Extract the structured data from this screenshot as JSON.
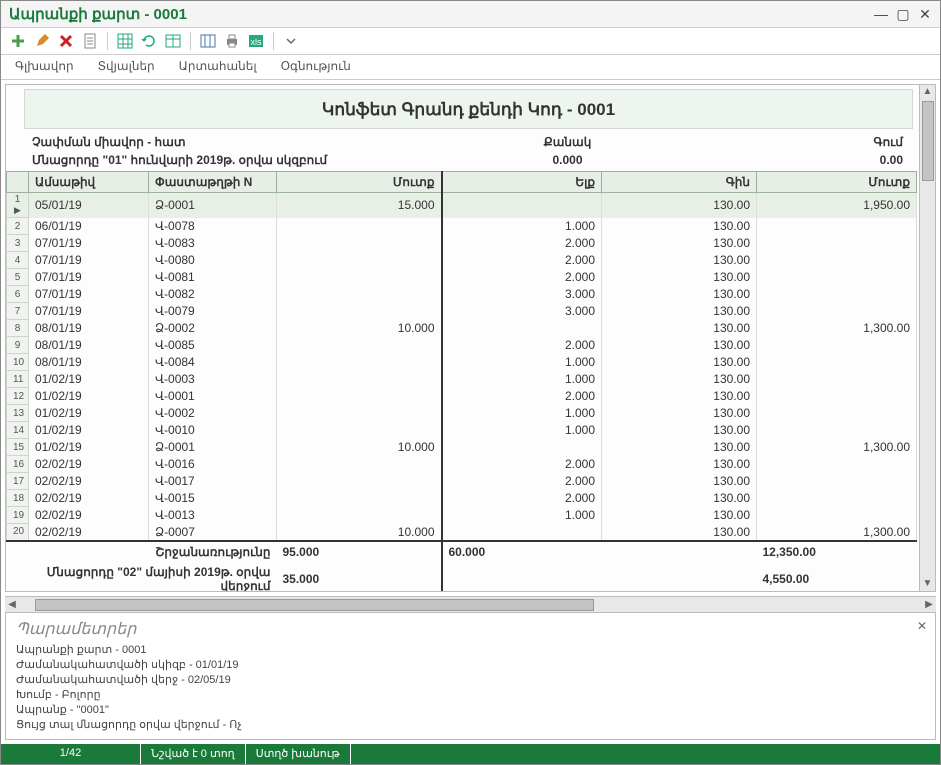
{
  "window": {
    "title": "Ապրանքի քարտ - 0001"
  },
  "menu": {
    "m1": "Գլխավոր",
    "m2": "Տվյալներ",
    "m3": "Արտահանել",
    "m4": "Օգնություն"
  },
  "report": {
    "title": "Կոնֆետ Գրանդ քենդի Կոդ - 0001",
    "unit_label": "Չափման միավոր - հատ",
    "qty_label": "Քանակ",
    "amt_label": "Գում",
    "remainder_label": "Մնացորդը \"01\" հունվարի 2019թ. օրվա սկզբում",
    "qty_start": "0.000",
    "amt_start": "0.00",
    "headers": {
      "date": "Ամսաթիվ",
      "doc": "Փաստաթղթի N",
      "in": "Մուտք",
      "out": "Ելք",
      "price": "Գին",
      "amt": "Մուտք"
    },
    "rows": [
      {
        "i": "1",
        "date": "05/01/19",
        "doc": "Ձ-0001",
        "in": "15.000",
        "out": "",
        "price": "130.00",
        "amt": "1,950.00"
      },
      {
        "i": "2",
        "date": "06/01/19",
        "doc": "Վ-0078",
        "in": "",
        "out": "1.000",
        "price": "130.00",
        "amt": ""
      },
      {
        "i": "3",
        "date": "07/01/19",
        "doc": "Վ-0083",
        "in": "",
        "out": "2.000",
        "price": "130.00",
        "amt": ""
      },
      {
        "i": "4",
        "date": "07/01/19",
        "doc": "Վ-0080",
        "in": "",
        "out": "2.000",
        "price": "130.00",
        "amt": ""
      },
      {
        "i": "5",
        "date": "07/01/19",
        "doc": "Վ-0081",
        "in": "",
        "out": "2.000",
        "price": "130.00",
        "amt": ""
      },
      {
        "i": "6",
        "date": "07/01/19",
        "doc": "Վ-0082",
        "in": "",
        "out": "3.000",
        "price": "130.00",
        "amt": ""
      },
      {
        "i": "7",
        "date": "07/01/19",
        "doc": "Վ-0079",
        "in": "",
        "out": "3.000",
        "price": "130.00",
        "amt": ""
      },
      {
        "i": "8",
        "date": "08/01/19",
        "doc": "Ձ-0002",
        "in": "10.000",
        "out": "",
        "price": "130.00",
        "amt": "1,300.00"
      },
      {
        "i": "9",
        "date": "08/01/19",
        "doc": "Վ-0085",
        "in": "",
        "out": "2.000",
        "price": "130.00",
        "amt": ""
      },
      {
        "i": "10",
        "date": "08/01/19",
        "doc": "Վ-0084",
        "in": "",
        "out": "1.000",
        "price": "130.00",
        "amt": ""
      },
      {
        "i": "11",
        "date": "01/02/19",
        "doc": "Վ-0003",
        "in": "",
        "out": "1.000",
        "price": "130.00",
        "amt": ""
      },
      {
        "i": "12",
        "date": "01/02/19",
        "doc": "Վ-0001",
        "in": "",
        "out": "2.000",
        "price": "130.00",
        "amt": ""
      },
      {
        "i": "13",
        "date": "01/02/19",
        "doc": "Վ-0002",
        "in": "",
        "out": "1.000",
        "price": "130.00",
        "amt": ""
      },
      {
        "i": "14",
        "date": "01/02/19",
        "doc": "Վ-0010",
        "in": "",
        "out": "1.000",
        "price": "130.00",
        "amt": ""
      },
      {
        "i": "15",
        "date": "01/02/19",
        "doc": "Ձ-0001",
        "in": "10.000",
        "out": "",
        "price": "130.00",
        "amt": "1,300.00"
      },
      {
        "i": "16",
        "date": "02/02/19",
        "doc": "Վ-0016",
        "in": "",
        "out": "2.000",
        "price": "130.00",
        "amt": ""
      },
      {
        "i": "17",
        "date": "02/02/19",
        "doc": "Վ-0017",
        "in": "",
        "out": "2.000",
        "price": "130.00",
        "amt": ""
      },
      {
        "i": "18",
        "date": "02/02/19",
        "doc": "Վ-0015",
        "in": "",
        "out": "2.000",
        "price": "130.00",
        "amt": ""
      },
      {
        "i": "19",
        "date": "02/02/19",
        "doc": "Վ-0013",
        "in": "",
        "out": "1.000",
        "price": "130.00",
        "amt": ""
      },
      {
        "i": "20",
        "date": "02/02/19",
        "doc": "Ձ-0007",
        "in": "10.000",
        "out": "",
        "price": "130.00",
        "amt": "1,300.00"
      }
    ],
    "totals": {
      "label": "Շրջանառությունը",
      "in": "95.000",
      "out": "60.000",
      "amt": "12,350.00"
    },
    "end_balance": {
      "label": "Մնացորդը \"02\" մայիսի 2019թ. օրվա վերջում",
      "in": "35.000",
      "amt": "4,550.00"
    }
  },
  "params": {
    "title": "Պարամետրեր",
    "l1": "Ապրանքի քարտ - 0001",
    "l2": "Ժամանակահատվածի սկիզբ  - 01/01/19",
    "l3": "Ժամանակահատվածի վերջ  - 02/05/19",
    "l4": "Խումբ  - Բոլորը",
    "l5": "Ապրանք  - \"0001\"",
    "l6": "Ցույց տալ մնացորդը օրվա վերջում  - Ոչ"
  },
  "status": {
    "pos": "1/42",
    "sel": "Նշված է 0 տող",
    "place": "Ստղծ խանութ"
  }
}
